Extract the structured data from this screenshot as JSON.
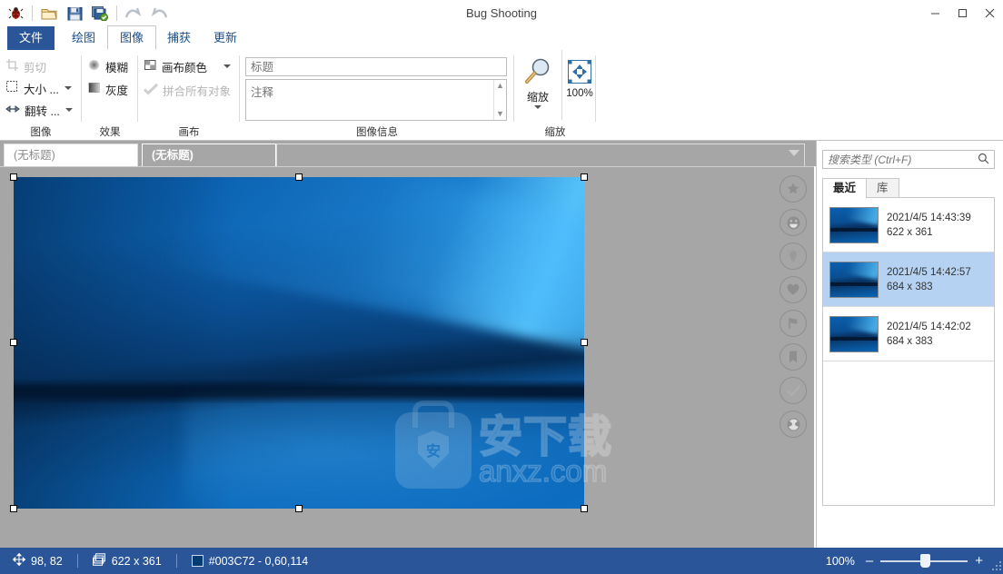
{
  "window": {
    "title": "Bug Shooting",
    "minimize_label": "─",
    "maximize_label": "☐",
    "close_label": "✕"
  },
  "quick_access": {
    "items": [
      {
        "name": "bug-icon",
        "tooltip": "Bug Shooting"
      },
      {
        "name": "open-folder-icon",
        "tooltip": "Open"
      },
      {
        "name": "save-icon",
        "tooltip": "Save"
      },
      {
        "name": "save-all-icon",
        "tooltip": "Save all"
      },
      {
        "name": "undo-icon",
        "tooltip": "Undo"
      },
      {
        "name": "redo-icon",
        "tooltip": "Redo"
      }
    ]
  },
  "ribbon": {
    "tabs": [
      {
        "label": "文件",
        "id": "file",
        "state": "file"
      },
      {
        "label": "绘图",
        "id": "draw",
        "state": "normal"
      },
      {
        "label": "图像",
        "id": "image",
        "state": "active"
      },
      {
        "label": "捕获",
        "id": "capture",
        "state": "normal"
      },
      {
        "label": "更新",
        "id": "update",
        "state": "normal",
        "badge": "!"
      }
    ],
    "collapse_label": "∧",
    "help_label": "?",
    "groups": [
      {
        "label": "图像",
        "items": [
          {
            "label": "剪切",
            "icon": "crop-icon",
            "disabled": true,
            "dropdown": false
          },
          {
            "label": "大小 ...",
            "icon": "resize-icon",
            "disabled": false,
            "dropdown": true
          },
          {
            "label": "翻转 ...",
            "icon": "flip-icon",
            "disabled": false,
            "dropdown": true
          }
        ]
      },
      {
        "label": "效果",
        "items": [
          {
            "label": "模糊",
            "icon": "blur-icon",
            "disabled": false,
            "dropdown": false
          },
          {
            "label": "灰度",
            "icon": "grayscale-icon",
            "disabled": false,
            "dropdown": false
          }
        ]
      },
      {
        "label": "画布",
        "items": [
          {
            "label": "画布颜色",
            "icon": "canvas-color-icon",
            "disabled": false,
            "dropdown": true
          },
          {
            "label": "拼合所有对象",
            "icon": "merge-objects-icon",
            "disabled": true,
            "dropdown": false
          }
        ]
      },
      {
        "label": "图像信息",
        "title_placeholder": "标题",
        "title_value": "",
        "note_placeholder": "注释",
        "note_value": ""
      },
      {
        "label": "缩放",
        "zoom_button_label": "缩放",
        "zoom_reset_label": "100%"
      }
    ]
  },
  "document_tabs": {
    "tabs": [
      {
        "label": "(无标题)",
        "active": false
      },
      {
        "label": "(无标题)",
        "active": true
      }
    ]
  },
  "canvas": {
    "selection_handles": 8,
    "watermark": {
      "cn": "安下载",
      "en": "anxz.com",
      "badge_char": "安"
    },
    "rail_icons": [
      {
        "name": "star-icon",
        "glyph": "★"
      },
      {
        "name": "smiley-icon",
        "glyph": "☻"
      },
      {
        "name": "lightbulb-icon",
        "glyph": "Ὂ1"
      },
      {
        "name": "heart-icon",
        "glyph": "♥"
      },
      {
        "name": "flag-icon",
        "glyph": "⚑"
      },
      {
        "name": "bookmark-icon",
        "glyph": "⚑"
      },
      {
        "name": "check-icon",
        "glyph": "✓"
      },
      {
        "name": "radiation-icon",
        "glyph": "☢"
      }
    ]
  },
  "right_panel": {
    "search_placeholder": "搜索类型 (Ctrl+F)",
    "search_value": "",
    "tabs": [
      {
        "label": "最近",
        "active": true
      },
      {
        "label": "库",
        "active": false
      }
    ],
    "items": [
      {
        "timestamp": "2021/4/5 14:43:39",
        "size": "622 x 361",
        "selected": false
      },
      {
        "timestamp": "2021/4/5 14:42:57",
        "size": "684 x 383",
        "selected": true
      },
      {
        "timestamp": "2021/4/5 14:42:02",
        "size": "684 x 383",
        "selected": false
      }
    ]
  },
  "status_bar": {
    "cursor_position": "98, 82",
    "image_size": "622 x 361",
    "color_value": "#003C72 - 0,60,114",
    "color_hex": "#003C72",
    "zoom_level": "100%",
    "zoom_out_label": "–",
    "zoom_in_label": "+"
  }
}
